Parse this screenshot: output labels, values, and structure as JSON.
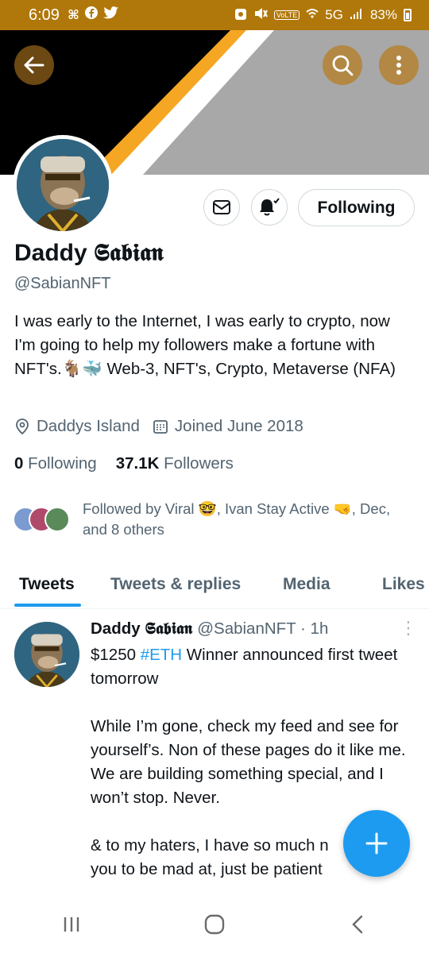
{
  "status_bar": {
    "time": "6:09",
    "network": "5G",
    "battery": "83%",
    "volte": "VoLTE"
  },
  "profile": {
    "name": "Daddy 𝕾𝖆𝖇𝖎𝖆𝖓",
    "handle": "@SabianNFT",
    "bio": "I was early to the Internet, I was early to crypto, now I'm going to help my followers make a fortune with NFT's.🐐🐳 Web-3, NFT's, Crypto, Metaverse (NFA)",
    "location": "Daddys Island",
    "joined": "Joined June 2018",
    "following_count": "0",
    "following_label": "Following",
    "followers_count": "37.1K",
    "followers_label": "Followers",
    "followed_by": "Followed by Viral 🤓, Ivan Stay Active 🤜, Dec, and 8 others",
    "following_button": "Following"
  },
  "tabs": [
    {
      "label": "Tweets"
    },
    {
      "label": "Tweets & replies"
    },
    {
      "label": "Media"
    },
    {
      "label": "Likes"
    }
  ],
  "tweet": {
    "name": "Daddy 𝕾𝖆𝖇𝖎𝖆𝖓",
    "meta": "@SabianNFT · 1h",
    "text_prefix": "$1250 ",
    "hashtag": "#ETH",
    "text_rest": " Winner announced first tweet tomorrow\n\nWhile I’m gone, check my feed and see for yourself’s. Non of these pages do it like me. We are building something special, and I won’t stop. Never.\n\n& to my haters, I have so much n\nyou to be mad at, just be patient"
  },
  "colors": {
    "status_bar": "#b0780a",
    "accent_blue": "#1d9bf0",
    "banner_orange": "#f5a623",
    "banner_gray": "#a9a9a9"
  }
}
